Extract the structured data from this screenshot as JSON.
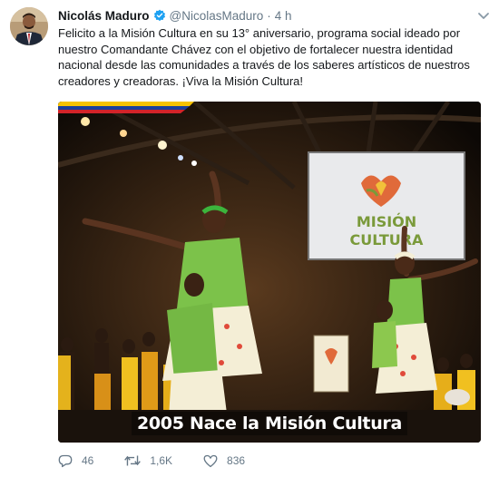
{
  "tweet": {
    "author_name": "Nicolás Maduro",
    "handle": "@NicolasMaduro",
    "separator": "·",
    "time": "4 h",
    "text_lines": [
      "Felicito a la Misión Cultura en su 13° aniversario, programa social ideado por",
      "nuestro Comandante Chávez con el objetivo de fortalecer nuestra identidad",
      "nacional desde las comunidades a través de los saberes artísticos de nuestros",
      "creadores y creadoras. ¡Viva la Misión Cultura!"
    ],
    "media": {
      "sign_line1": "MISIÓN",
      "sign_line2": "CULTURA",
      "caption": "2005 Nace la Misión Cultura"
    },
    "stats": {
      "replies": "46",
      "retweets": "1,6K",
      "likes": "836"
    }
  },
  "icons": {
    "verified": "verified-badge-icon",
    "caret": "chevron-down-icon",
    "reply": "reply-icon",
    "retweet": "retweet-icon",
    "like": "heart-icon"
  },
  "colors": {
    "verified_blue": "#1da1f2",
    "muted": "#657786",
    "text": "#14171a",
    "flag_yellow": "#f7c200",
    "flag_blue": "#1c3f9b",
    "flag_red": "#d2232a"
  }
}
